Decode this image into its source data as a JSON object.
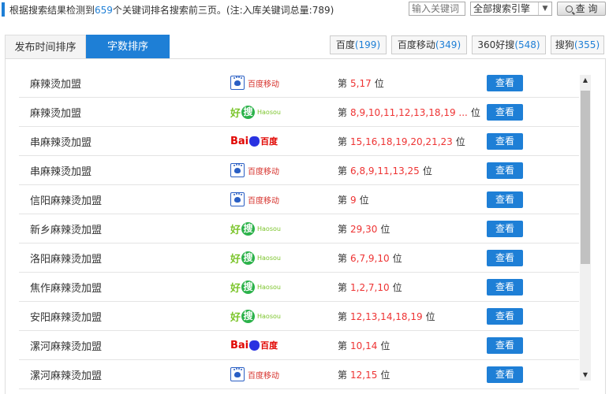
{
  "header": {
    "summary_prefix": "根据搜索结果检测到",
    "summary_count": "659",
    "summary_suffix": "个关键词排名搜索前三页。(注:入库关键词总量:789)",
    "keyword_placeholder": "输入关键词",
    "engine_selected": "全部搜索引擎",
    "search_label": "查 询"
  },
  "sort_tabs": [
    {
      "label": "发布时间排序",
      "active": false
    },
    {
      "label": "字数排序",
      "active": true
    }
  ],
  "engine_tabs": [
    {
      "name": "百度",
      "count": "(199)"
    },
    {
      "name": "百度移动",
      "count": "(349)"
    },
    {
      "name": "360好搜",
      "count": "(548)"
    },
    {
      "name": "搜狗",
      "count": "(355)"
    }
  ],
  "rank_prefix": "第",
  "rank_suffix": "位",
  "view_label": "查看",
  "logo_text": {
    "baidu_mobile": "百度移动",
    "haosou_hao": "好",
    "haosou_sou": "搜",
    "haosou_en": "Haosou",
    "baidu_bai": "Bai",
    "baidu_cn": "百度"
  },
  "rows": [
    {
      "keyword": "麻辣烫加盟",
      "engine": "baidu_mobile",
      "positions": "5,17"
    },
    {
      "keyword": "麻辣烫加盟",
      "engine": "haosou",
      "positions": "8,9,10,11,12,13,18,19 ..."
    },
    {
      "keyword": "串麻辣烫加盟",
      "engine": "baidu",
      "positions": "15,16,18,19,20,21,23"
    },
    {
      "keyword": "串麻辣烫加盟",
      "engine": "baidu_mobile",
      "positions": "6,8,9,11,13,25"
    },
    {
      "keyword": "信阳麻辣烫加盟",
      "engine": "baidu_mobile",
      "positions": "9"
    },
    {
      "keyword": "新乡麻辣烫加盟",
      "engine": "haosou",
      "positions": "29,30"
    },
    {
      "keyword": "洛阳麻辣烫加盟",
      "engine": "haosou",
      "positions": "6,7,9,10"
    },
    {
      "keyword": "焦作麻辣烫加盟",
      "engine": "haosou",
      "positions": "1,2,7,10"
    },
    {
      "keyword": "安阳麻辣烫加盟",
      "engine": "haosou",
      "positions": "12,13,14,18,19"
    },
    {
      "keyword": "漯河麻辣烫加盟",
      "engine": "baidu",
      "positions": "10,14"
    },
    {
      "keyword": "漯河麻辣烫加盟",
      "engine": "baidu_mobile",
      "positions": "12,15"
    }
  ]
}
